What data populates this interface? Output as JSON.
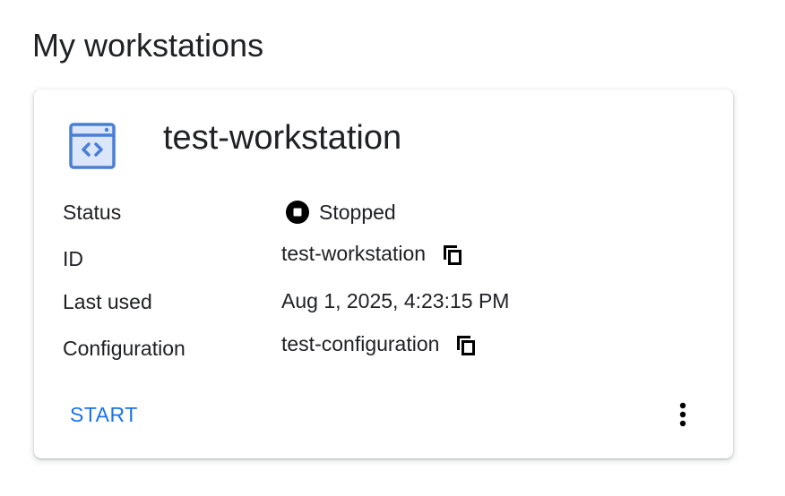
{
  "page": {
    "title": "My workstations"
  },
  "workstation": {
    "name": "test-workstation",
    "icon": "code-browser-icon",
    "rows": {
      "status": {
        "label": "Status",
        "value": "Stopped",
        "icon": "stop-circle-icon"
      },
      "id": {
        "label": "ID",
        "value": "test-workstation",
        "icon": "copy-icon"
      },
      "last_used": {
        "label": "Last used",
        "value": "Aug 1, 2025, 4:23:15 PM"
      },
      "configuration": {
        "label": "Configuration",
        "value": "test-configuration",
        "icon": "copy-icon"
      }
    },
    "actions": {
      "start_label": "START",
      "more_icon": "more-vert-icon"
    }
  },
  "colors": {
    "accent": "#1a73e8",
    "icon_blue": "#4a7fd4",
    "text": "#202124"
  }
}
